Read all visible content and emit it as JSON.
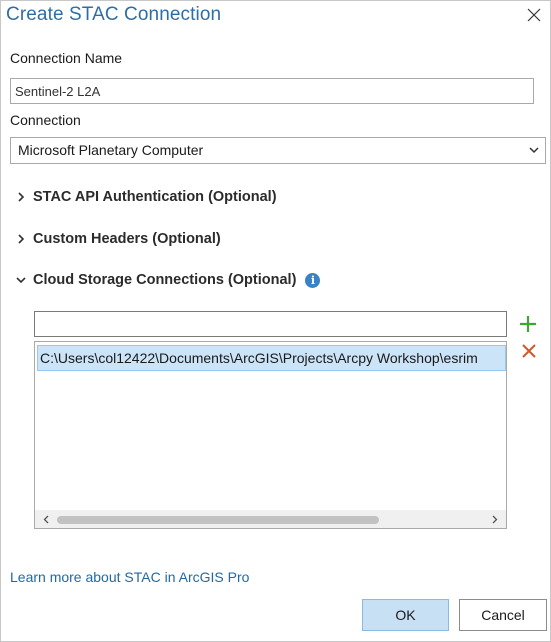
{
  "window": {
    "title": "Create STAC Connection"
  },
  "connection_name": {
    "label": "Connection Name",
    "value": "Sentinel-2 L2A"
  },
  "connection": {
    "label": "Connection",
    "selected": "Microsoft Planetary Computer"
  },
  "sections": {
    "auth": "STAC API Authentication (Optional)",
    "headers": "Custom Headers (Optional)",
    "cloud_storage": "Cloud Storage Connections (Optional)"
  },
  "cloud_storage": {
    "input_value": "",
    "items": [
      "C:\\Users\\col12422\\Documents\\ArcGIS\\Projects\\Arcpy Workshop\\esrim"
    ]
  },
  "footer": {
    "learn_more": "Learn more about STAC in ArcGIS Pro",
    "ok_label": "OK",
    "cancel_label": "Cancel"
  },
  "colors": {
    "title": "#2f6ea5",
    "link": "#1f6aa6",
    "add": "#3fa535",
    "remove": "#d4572b",
    "selection": "#cce4f7"
  }
}
